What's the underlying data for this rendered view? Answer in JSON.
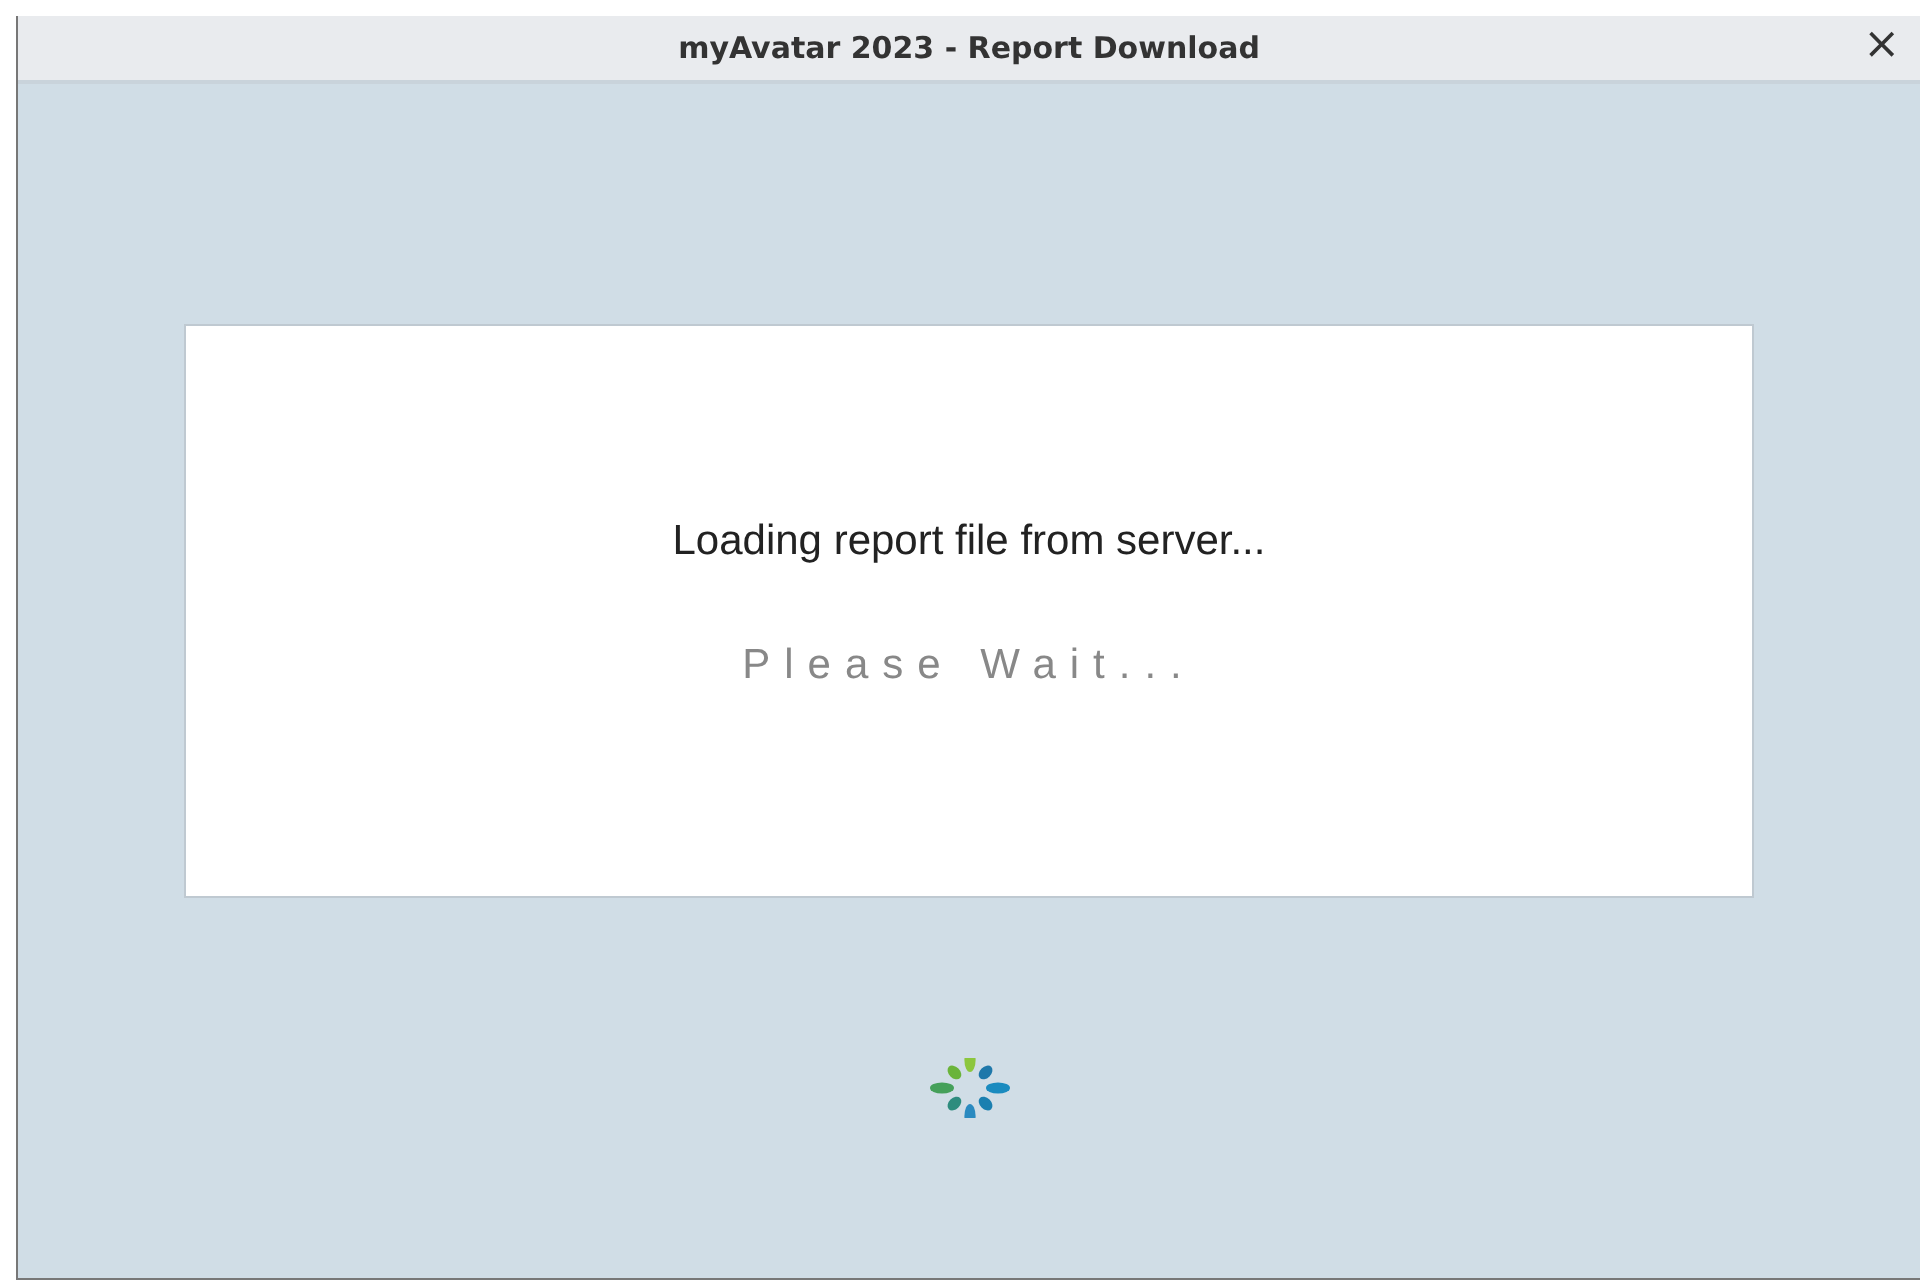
{
  "window": {
    "title": "myAvatar 2023 - Report Download",
    "close": "×"
  },
  "message": {
    "text": "Loading report file from server...",
    "subtext": "Please Wait..."
  }
}
